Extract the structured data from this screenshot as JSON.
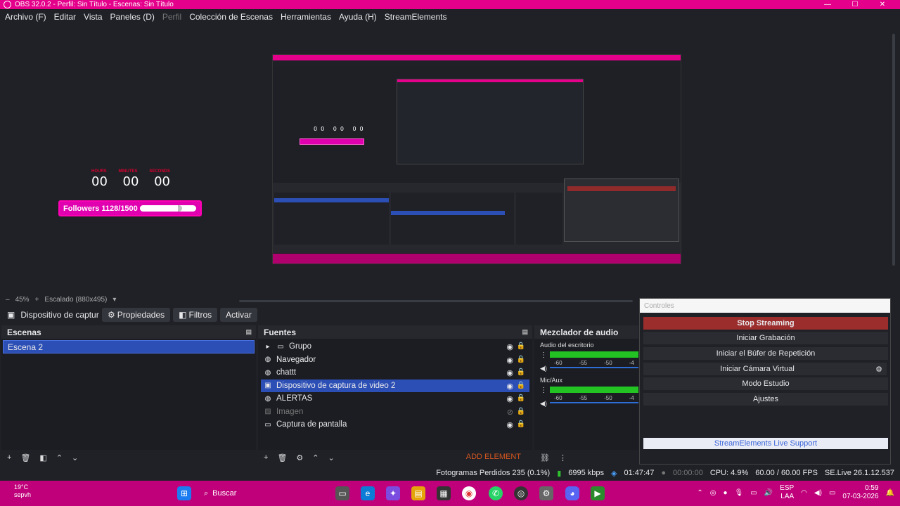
{
  "window": {
    "title": "OBS 32.0.2 - Perfil: Sin Título - Escenas: Sin Título",
    "minimize": "—",
    "maximize": "☐",
    "close": "✕"
  },
  "menu": {
    "items": [
      "Archivo (F)",
      "Editar",
      "Vista",
      "Paneles (D)",
      "Perfil",
      "Colección de Escenas",
      "Herramientas",
      "Ayuda (H)",
      "StreamElements"
    ]
  },
  "preview": {
    "timer": {
      "labels": [
        "HOURS",
        "MINUTES",
        "SECONDS"
      ],
      "values": [
        "00",
        "00",
        "00"
      ]
    },
    "followers_label": "Followers 1128/1500",
    "followers_progress": 0.752,
    "zoom": "45%",
    "scale_label": "Escalado (880x495)"
  },
  "toolbar": {
    "source_name": "Dispositivo de captur",
    "properties": "Propiedades",
    "filters": "Filtros",
    "activate": "Activar"
  },
  "scenes": {
    "title": "Escenas",
    "items": [
      "Escena 2"
    ]
  },
  "sources": {
    "title": "Fuentes",
    "items": [
      {
        "name": "Grupo",
        "icon": "folder-icon"
      },
      {
        "name": "Navegador",
        "icon": "globe-icon"
      },
      {
        "name": "chattt",
        "icon": "globe-icon"
      },
      {
        "name": "Dispositivo de captura de video 2",
        "icon": "camera-icon"
      },
      {
        "name": "ALERTAS",
        "icon": "globe-icon"
      },
      {
        "name": "Imagen",
        "icon": "image-icon"
      },
      {
        "name": "Captura de pantalla",
        "icon": "monitor-icon"
      }
    ],
    "add_element": "ADD ELEMENT"
  },
  "mixer": {
    "title": "Mezclador de audio",
    "channels": [
      {
        "name": "Audio del escritorio",
        "ticks": [
          "-60",
          "-55",
          "-50",
          "-4"
        ]
      },
      {
        "name": "Mic/Aux",
        "ticks": [
          "-60",
          "-55",
          "-50",
          "-4"
        ]
      }
    ]
  },
  "controls": {
    "title": "Controles",
    "stop_streaming": "Stop Streaming",
    "start_recording": "Iniciar Grabación",
    "start_replay": "Iniciar el Búfer de Repetición",
    "start_virtual_cam": "Iniciar Cámara Virtual",
    "studio_mode": "Modo Estudio",
    "settings": "Ajustes",
    "live_support": "StreamElements Live Support"
  },
  "status": {
    "dropped_frames": "Fotogramas Perdidos 235 (0.1%)",
    "bitrate": "6995 kbps",
    "stream_time": "01:47:47",
    "record_time": "00:00:00",
    "cpu": "CPU: 4.9%",
    "fps": "60.00 / 60.00 FPS",
    "se_live": "SE.Live 26.1.12.537"
  },
  "taskbar": {
    "weather_temp": "19°C",
    "weather_text": "sepvh",
    "search": "Buscar",
    "lang_1": "ESP",
    "lang_2": "LAA",
    "time": "0:59",
    "date": "07-03-2026"
  }
}
